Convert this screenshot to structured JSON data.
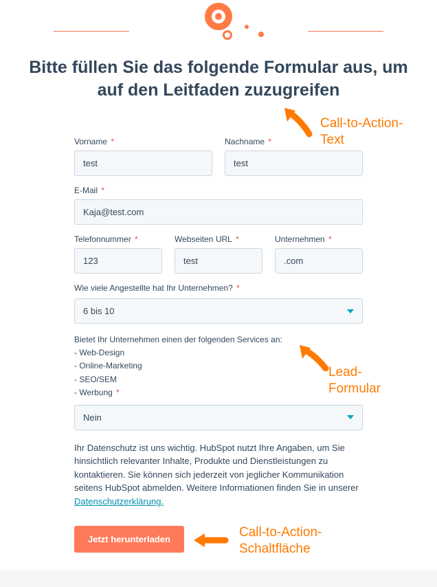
{
  "headline": "Bitte füllen Sie das folgende Formular aus, um auf den Leitfaden zuzugreifen",
  "fields": {
    "firstName": {
      "label": "Vorname",
      "value": "test"
    },
    "lastName": {
      "label": "Nachname",
      "value": "test"
    },
    "email": {
      "label": "E-Mail",
      "value": "Kaja@test.com"
    },
    "phone": {
      "label": "Telefonnummer",
      "value": "123"
    },
    "website": {
      "label": "Webseiten URL",
      "value": "test"
    },
    "company": {
      "label": "Unternehmen",
      "value": ".com"
    }
  },
  "employees": {
    "label": "Wie viele Angestellte hat Ihr Unternehmen?",
    "value": "6 bis 10"
  },
  "services": {
    "intro": "Bietet Ihr Unternehmen einen der folgenden Services an:",
    "items": [
      "- Web-Design",
      "- Online-Marketing",
      "- SEO/SEM",
      "- Werbung"
    ],
    "value": "Nein"
  },
  "privacy": {
    "text": "Ihr Datenschutz ist uns wichtig. HubSpot nutzt Ihre Angaben, um Sie hinsichtlich relevanter Inhalte, Produkte und Dienstleistungen zu kontaktieren. Sie können sich jederzeit von jeglicher Kommunikation seitens HubSpot abmelden. Weitere Informationen finden Sie in unserer ",
    "linkText": "Datenschutzerklärung."
  },
  "submitLabel": "Jetzt herunterladen",
  "annotations": {
    "ctaText": "Call-to-Action-\nText",
    "leadForm": "Lead-\nFormular",
    "ctaButton": "Call-to-Action-\nSchaltfläche"
  }
}
